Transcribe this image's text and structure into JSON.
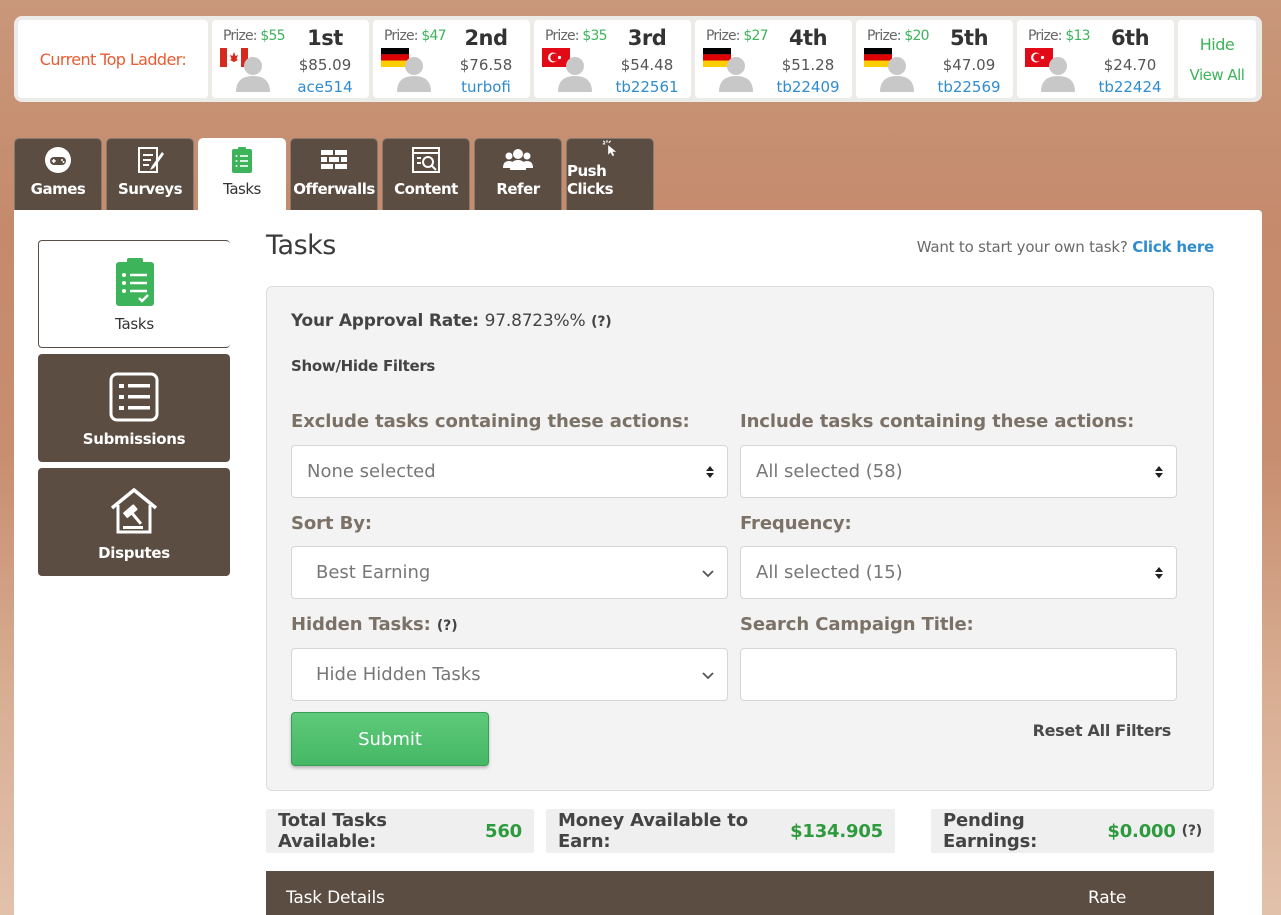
{
  "ladder": {
    "title": "Current Top Ladder:",
    "entries": [
      {
        "prize_label": "Prize:",
        "prize": "$55",
        "place": "1st",
        "earnings": "$85.09",
        "user": "ace514",
        "flag": "canada"
      },
      {
        "prize_label": "Prize:",
        "prize": "$47",
        "place": "2nd",
        "earnings": "$76.58",
        "user": "turbofi",
        "flag": "germany"
      },
      {
        "prize_label": "Prize:",
        "prize": "$35",
        "place": "3rd",
        "earnings": "$54.48",
        "user": "tb22561",
        "flag": "turkey"
      },
      {
        "prize_label": "Prize:",
        "prize": "$27",
        "place": "4th",
        "earnings": "$51.28",
        "user": "tb22409",
        "flag": "germany"
      },
      {
        "prize_label": "Prize:",
        "prize": "$20",
        "place": "5th",
        "earnings": "$47.09",
        "user": "tb22569",
        "flag": "germany"
      },
      {
        "prize_label": "Prize:",
        "prize": "$13",
        "place": "6th",
        "earnings": "$24.70",
        "user": "tb22424",
        "flag": "turkey"
      }
    ],
    "hide_label": "Hide",
    "view_all_label": "View All"
  },
  "tabs": [
    {
      "label": "Games",
      "icon": "gamepad-icon"
    },
    {
      "label": "Surveys",
      "icon": "survey-icon"
    },
    {
      "label": "Tasks",
      "icon": "clipboard-icon",
      "active": true
    },
    {
      "label": "Offerwalls",
      "icon": "wall-icon"
    },
    {
      "label": "Content",
      "icon": "content-icon"
    },
    {
      "label": "Refer",
      "icon": "users-icon"
    },
    {
      "label": "Push Clicks",
      "icon": "cursor-click-icon"
    }
  ],
  "sidebar": {
    "items": [
      {
        "label": "Tasks",
        "icon": "clipboard-icon",
        "active": true
      },
      {
        "label": "Submissions",
        "icon": "list-icon"
      },
      {
        "label": "Disputes",
        "icon": "gavel-icon"
      }
    ]
  },
  "main": {
    "title": "Tasks",
    "own_task_text": "Want to start your own task?",
    "own_task_link": "Click here"
  },
  "filters": {
    "approval_label": "Your Approval Rate:",
    "approval_value": "97.8723%%",
    "approval_help": "(?)",
    "show_hide": "Show/Hide Filters",
    "exclude_label": "Exclude tasks containing these actions:",
    "exclude_value": "None selected",
    "include_label": "Include tasks containing these actions:",
    "include_value": "All selected (58)",
    "sort_label": "Sort By:",
    "sort_value": "Best Earning",
    "frequency_label": "Frequency:",
    "frequency_value": "All selected (15)",
    "hidden_label": "Hidden Tasks:",
    "hidden_help": "(?)",
    "hidden_value": "Hide Hidden Tasks",
    "search_label": "Search Campaign Title:",
    "search_value": "",
    "submit_label": "Submit",
    "reset_label": "Reset All Filters"
  },
  "stats": {
    "total_label": "Total Tasks Available:",
    "total_value": "560",
    "money_label": "Money Available to Earn:",
    "money_value": "$134.905",
    "pending_label": "Pending Earnings:",
    "pending_value": "$0.000",
    "pending_help": "(?)"
  },
  "table": {
    "col_details": "Task Details",
    "col_rate": "Rate"
  },
  "colors": {
    "accent_green": "#3db35a",
    "brand_brown": "#5c4d43",
    "link_blue": "#2f8ccf",
    "ladder_title": "#e85c32"
  }
}
